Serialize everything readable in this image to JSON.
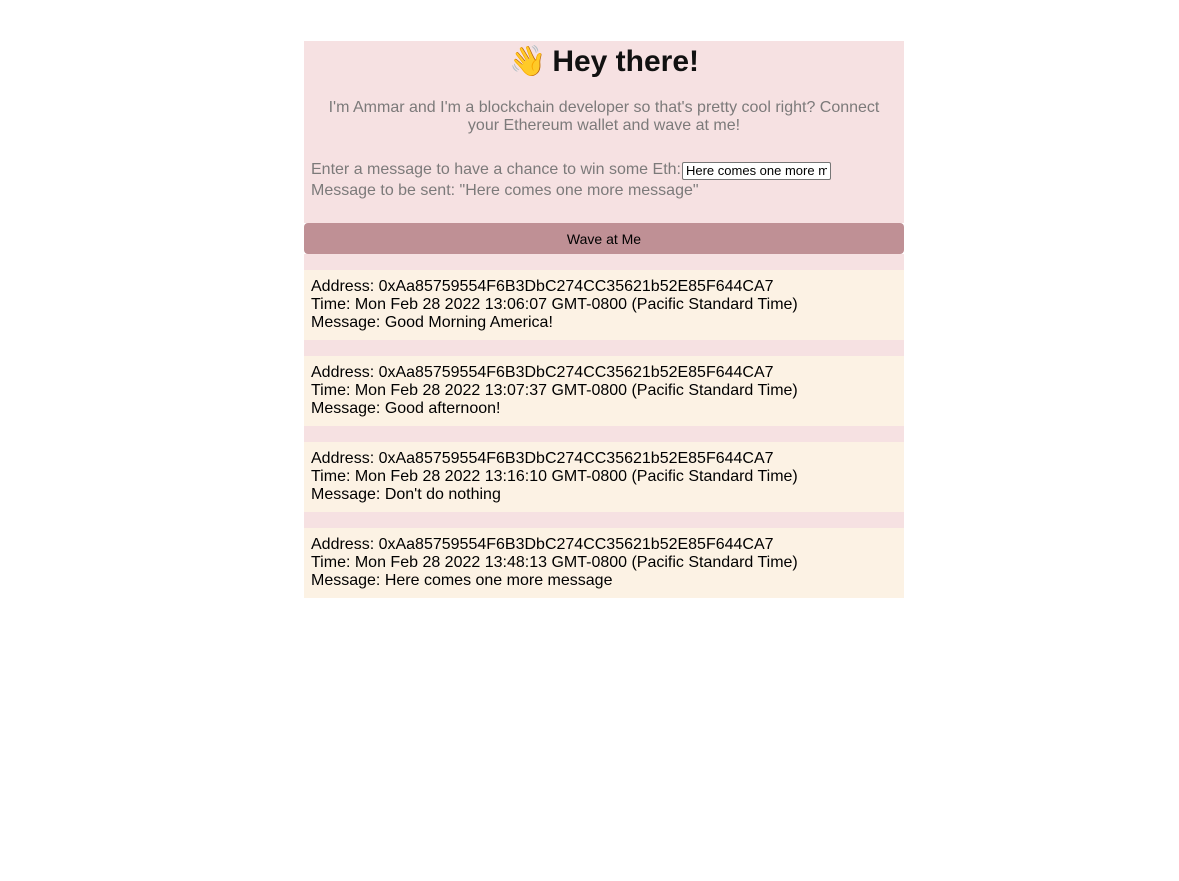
{
  "header": {
    "emoji": "👋",
    "title": "Hey there!"
  },
  "bio": "I'm Ammar and I'm a blockchain developer so that's pretty cool right? Connect your Ethereum wallet and wave at me!",
  "form": {
    "prompt": "Enter a message to have a chance to win some Eth:",
    "input_value": "Here comes one more message",
    "preview_prefix": "Message to be sent: \"",
    "preview_value": "Here comes one more message",
    "preview_suffix": "\""
  },
  "button": {
    "label": "Wave at Me"
  },
  "waves": [
    {
      "address": "Address: 0xAa85759554F6B3DbC274CC35621b52E85F644CA7",
      "time": "Time: Mon Feb 28 2022 13:06:07 GMT-0800 (Pacific Standard Time)",
      "message": "Message: Good Morning America!"
    },
    {
      "address": "Address: 0xAa85759554F6B3DbC274CC35621b52E85F644CA7",
      "time": "Time: Mon Feb 28 2022 13:07:37 GMT-0800 (Pacific Standard Time)",
      "message": "Message: Good afternoon!"
    },
    {
      "address": "Address: 0xAa85759554F6B3DbC274CC35621b52E85F644CA7",
      "time": "Time: Mon Feb 28 2022 13:16:10 GMT-0800 (Pacific Standard Time)",
      "message": "Message: Don't do nothing"
    },
    {
      "address": "Address: 0xAa85759554F6B3DbC274CC35621b52E85F644CA7",
      "time": "Time: Mon Feb 28 2022 13:48:13 GMT-0800 (Pacific Standard Time)",
      "message": "Message: Here comes one more message"
    }
  ],
  "colors": {
    "panel_bg": "#f6e1e2",
    "button_bg": "#bf9095",
    "card_bg": "#fcf2e4",
    "muted_text": "#7c7a7a"
  }
}
